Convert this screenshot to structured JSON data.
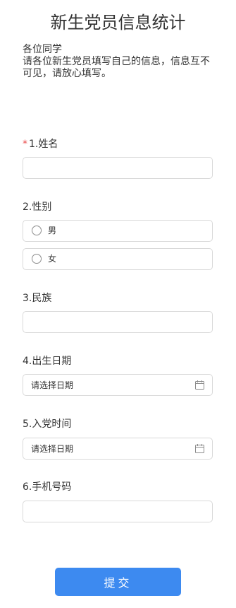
{
  "form": {
    "title": "新生党员信息统计",
    "greeting": "各位同学",
    "intro": "请各位新生党员填写自己的信息，信息互不可见，请放心填写。"
  },
  "questions": {
    "name": {
      "required_mark": "*",
      "label": "1.姓名",
      "value": ""
    },
    "gender": {
      "label": "2.性别",
      "options": [
        "男",
        "女"
      ]
    },
    "ethnicity": {
      "label": "3.民族",
      "value": ""
    },
    "birth_date": {
      "label": "4.出生日期",
      "placeholder": "请选择日期"
    },
    "join_date": {
      "label": "5.入党时间",
      "placeholder": "请选择日期"
    },
    "phone": {
      "label": "6.手机号码",
      "value": ""
    }
  },
  "submit_label": "提交",
  "icons": {
    "date_picker": "calendar-icon",
    "radio": "radio-unchecked-icon"
  },
  "colors": {
    "required": "#e94b4b",
    "submit_button": "#3d8af0",
    "border": "#d9d9d9"
  }
}
